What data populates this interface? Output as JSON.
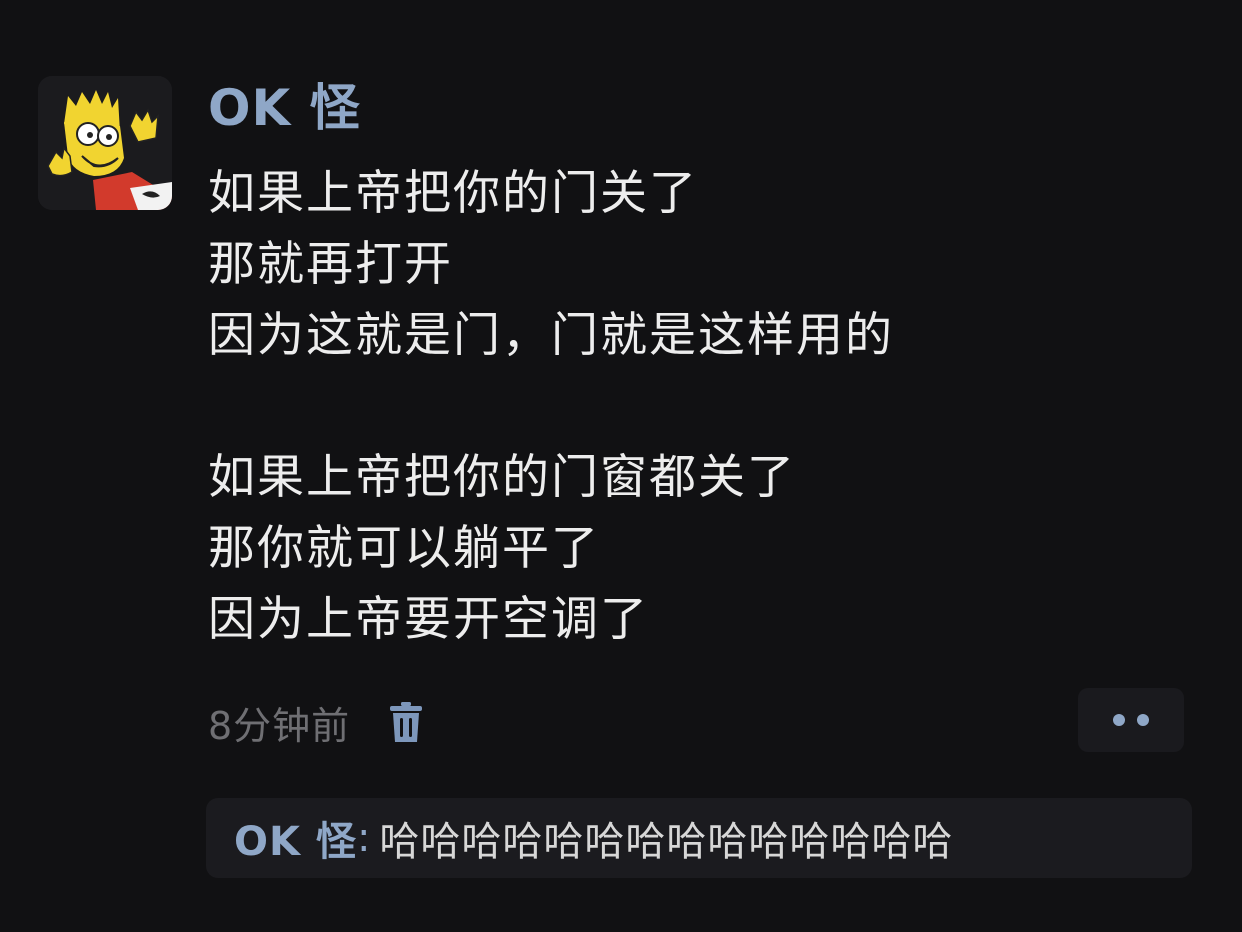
{
  "post": {
    "author": "OK 怪",
    "lines": [
      "如果上帝把你的门关了",
      "那就再打开",
      "因为这就是门，门就是这样用的",
      "",
      "如果上帝把你的门窗都关了",
      "那你就可以躺平了",
      "因为上帝要开空调了"
    ],
    "time": "8分钟前"
  },
  "icons": {
    "avatar": "cartoon-avatar",
    "delete": "trash-icon",
    "more": "more-dots-icon"
  },
  "comment": {
    "author": "OK 怪",
    "separator": ":",
    "text": "哈哈哈哈哈哈哈哈哈哈哈哈哈哈"
  },
  "colors": {
    "background": "#111113",
    "accent": "#8fa7c7",
    "text": "#ededed",
    "muted": "#6f6f73"
  }
}
